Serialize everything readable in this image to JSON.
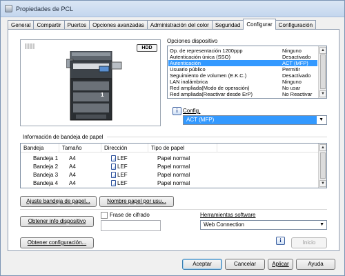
{
  "window": {
    "title": "Propiedades de PCL"
  },
  "tabs": [
    {
      "label": "General"
    },
    {
      "label": "Compartir"
    },
    {
      "label": "Puertos"
    },
    {
      "label": "Opciones avanzadas"
    },
    {
      "label": "Administración del color"
    },
    {
      "label": "Seguridad"
    },
    {
      "label": "Configurar",
      "active": true
    },
    {
      "label": "Configuración"
    }
  ],
  "preview": {
    "hdd_label": "HDD",
    "tray_number": "1"
  },
  "device_options": {
    "label": "Opciones dispositivo",
    "items": [
      {
        "name": "Op. de representación 1200ppp",
        "value": "Ninguno"
      },
      {
        "name": "Autenticación única (SSO)",
        "value": "Desactivado"
      },
      {
        "name": "Autenticación",
        "value": "ACT (MFP)",
        "selected": true
      },
      {
        "name": "Usuario público",
        "value": "Permitir"
      },
      {
        "name": "Seguimiento de volumen (E.K.C.)",
        "value": "Desactivado"
      },
      {
        "name": "LAN inalámbrica",
        "value": "Ninguno"
      },
      {
        "name": "Red ampliada(Modo de operación)",
        "value": "No usar"
      },
      {
        "name": "Red ampliada(Reactivar desde ErP)",
        "value": "No Reactivar"
      }
    ],
    "config_label": "Config.",
    "config_value": "ACT (MFP)"
  },
  "paper_tray": {
    "label": "Información de bandeja de papel",
    "columns": [
      "Bandeja",
      "Tamaño",
      "Dirección",
      "Tipo de papel"
    ],
    "rows": [
      {
        "tray": "Bandeja 1",
        "size": "A4",
        "direction": "LEF",
        "type": "Papel normal"
      },
      {
        "tray": "Bandeja 2",
        "size": "A4",
        "direction": "LEF",
        "type": "Papel normal"
      },
      {
        "tray": "Bandeja 3",
        "size": "A4",
        "direction": "LEF",
        "type": "Papel normal"
      },
      {
        "tray": "Bandeja 4",
        "size": "A4",
        "direction": "LEF",
        "type": "Papel normal"
      }
    ],
    "adjust_button": "Ajuste bandeja de papel...",
    "user_paper_button": "Nombre papel por usu..."
  },
  "device_info_button": "Obtener info dispositivo",
  "passphrase": {
    "label": "Frase de cifrado",
    "value": ""
  },
  "software_tools": {
    "label": "Herramientas software",
    "value": "Web Connection",
    "start_button": "Inicio"
  },
  "get_config_button": "Obtener configuración...",
  "footer": {
    "ok": "Aceptar",
    "cancel": "Cancelar",
    "apply": "Aplicar",
    "help": "Ayuda"
  },
  "colors": {
    "selection": "#3399ff",
    "accent_border": "#3c7fb1",
    "info_icon": "#1c3f8a"
  }
}
